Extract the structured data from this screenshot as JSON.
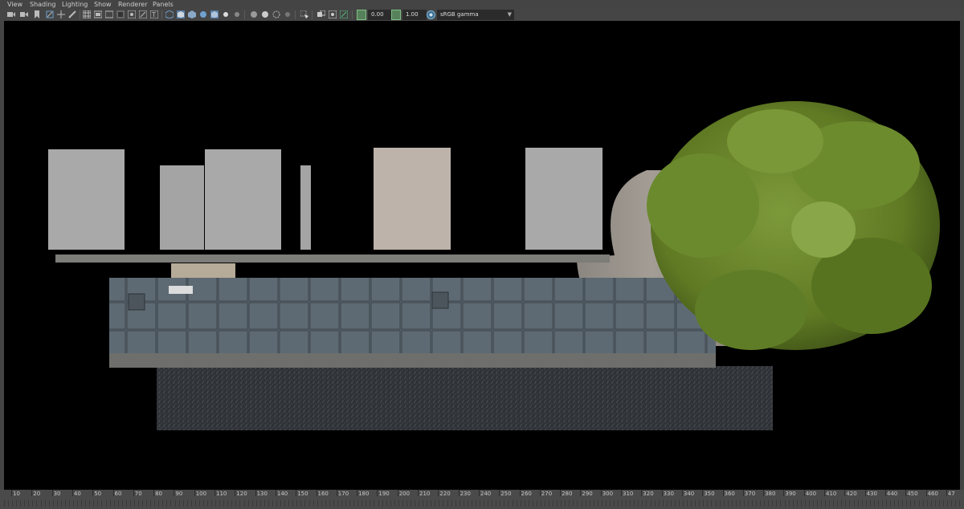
{
  "menu": [
    "View",
    "Shading",
    "Lighting",
    "Show",
    "Renderer",
    "Panels"
  ],
  "toolbar": {
    "exposure_value": "0.00",
    "gamma_value": "1.00",
    "color_space": "sRGB gamma"
  },
  "timeline": {
    "ticks": [
      "10",
      "20",
      "30",
      "40",
      "50",
      "60",
      "70",
      "80",
      "90",
      "100",
      "110",
      "120",
      "130",
      "140",
      "150",
      "160",
      "170",
      "180",
      "190",
      "200",
      "210",
      "220",
      "230",
      "240",
      "250",
      "260",
      "270",
      "280",
      "290",
      "300",
      "310",
      "320",
      "330",
      "340",
      "350",
      "360",
      "370",
      "380",
      "390",
      "400",
      "410",
      "420",
      "430",
      "440",
      "450",
      "460",
      "47"
    ]
  },
  "colors": {
    "viewport_bg": "#000000",
    "ui_bg": "#444444",
    "gray_plane": "#a9a9a9",
    "tree": "#6b8a2e",
    "gravel": "#2f3236",
    "paving": "#5b6670"
  }
}
